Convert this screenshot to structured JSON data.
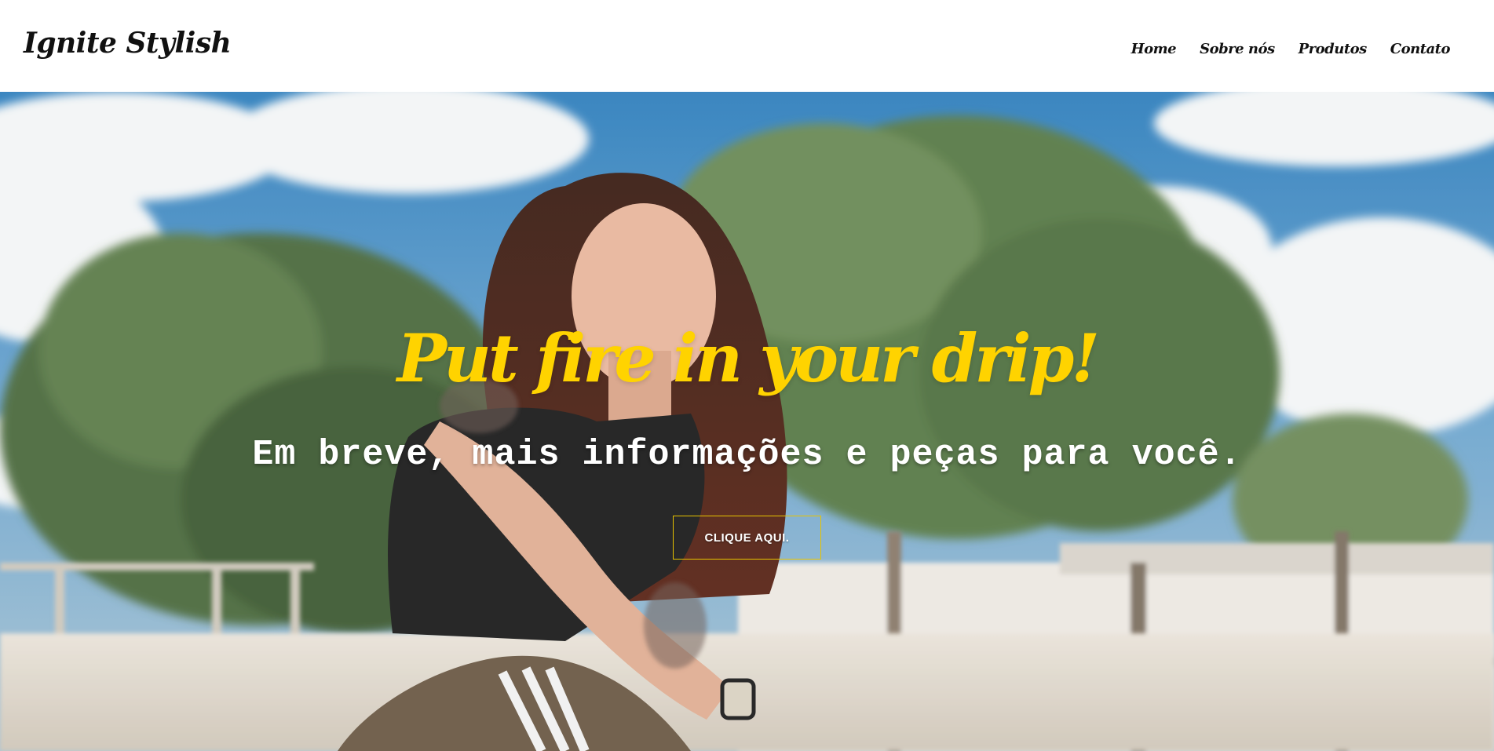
{
  "header": {
    "brand": "Ignite Stylish",
    "nav": [
      {
        "label": "Home"
      },
      {
        "label": "Sobre nós"
      },
      {
        "label": "Produtos"
      },
      {
        "label": "Contato"
      }
    ]
  },
  "hero": {
    "headline": "Put fire in your drip!",
    "subtitle": "Em breve, mais informações e peças para você.",
    "cta_label": "CLIQUE AQUI."
  },
  "colors": {
    "accent": "#ffd300",
    "header_bg": "#ffffff",
    "text_dark": "#111111"
  }
}
